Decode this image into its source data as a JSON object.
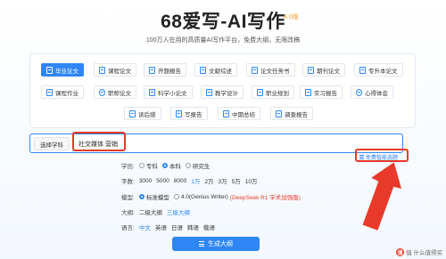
{
  "header": {
    "title": "68爱写-AI写作",
    "version": "4.0版",
    "subtitle": "100万人在用的高质量AI写作平台，免费大纲，无限改稿"
  },
  "paper_types": [
    {
      "label": "毕业论文",
      "active": true
    },
    {
      "label": "课程论文",
      "active": false
    },
    {
      "label": "开题报告",
      "active": false
    },
    {
      "label": "文献综述",
      "active": false
    },
    {
      "label": "论文任务书",
      "active": false
    },
    {
      "label": "期刊论文",
      "active": false
    },
    {
      "label": "专升本论文",
      "active": false
    },
    {
      "label": "课程作业",
      "active": false
    },
    {
      "label": "职称论文",
      "active": false
    },
    {
      "label": "科学小论文",
      "active": false
    },
    {
      "label": "教学设计",
      "active": false
    },
    {
      "label": "职业规划",
      "active": false
    },
    {
      "label": "实习报告",
      "active": false
    },
    {
      "label": "心得体会",
      "active": false
    },
    {
      "label": "读后感",
      "active": false
    },
    {
      "label": "写报告",
      "active": false
    },
    {
      "label": "中期总结",
      "active": false
    },
    {
      "label": "调查报告",
      "active": false
    }
  ],
  "subject": {
    "select_label": "选择学科",
    "value": "社交媒体 营销"
  },
  "ai_link": "免费智能选题",
  "education": {
    "label": "学历:",
    "options": [
      "专科",
      "本科",
      "研究生"
    ],
    "selected": "本科"
  },
  "word_count": {
    "label": "字数:",
    "options": [
      "3000",
      "5000",
      "8000",
      "1万",
      "2万",
      "3万",
      "5万",
      "10万"
    ],
    "selected": "1万"
  },
  "model": {
    "label": "模型:",
    "option_standard": "标准模型",
    "option_genius": "4.0(Genius Writer)",
    "genius_note": "(DeepSeek R1 学术加强版)",
    "selected": "标准模型"
  },
  "outline": {
    "label": "大纲:",
    "options": [
      "二级大纲",
      "三级大纲"
    ],
    "selected": "三级大纲"
  },
  "language": {
    "label": "语言:",
    "options": [
      "中文",
      "英语",
      "日语",
      "韩语",
      "俄语"
    ],
    "selected": "中文"
  },
  "generate_button": "生成大纲",
  "watermark": "值 什么值得买",
  "colors": {
    "accent": "#2f86f6",
    "highlight": "#e8392a",
    "version": "#f0a030"
  }
}
